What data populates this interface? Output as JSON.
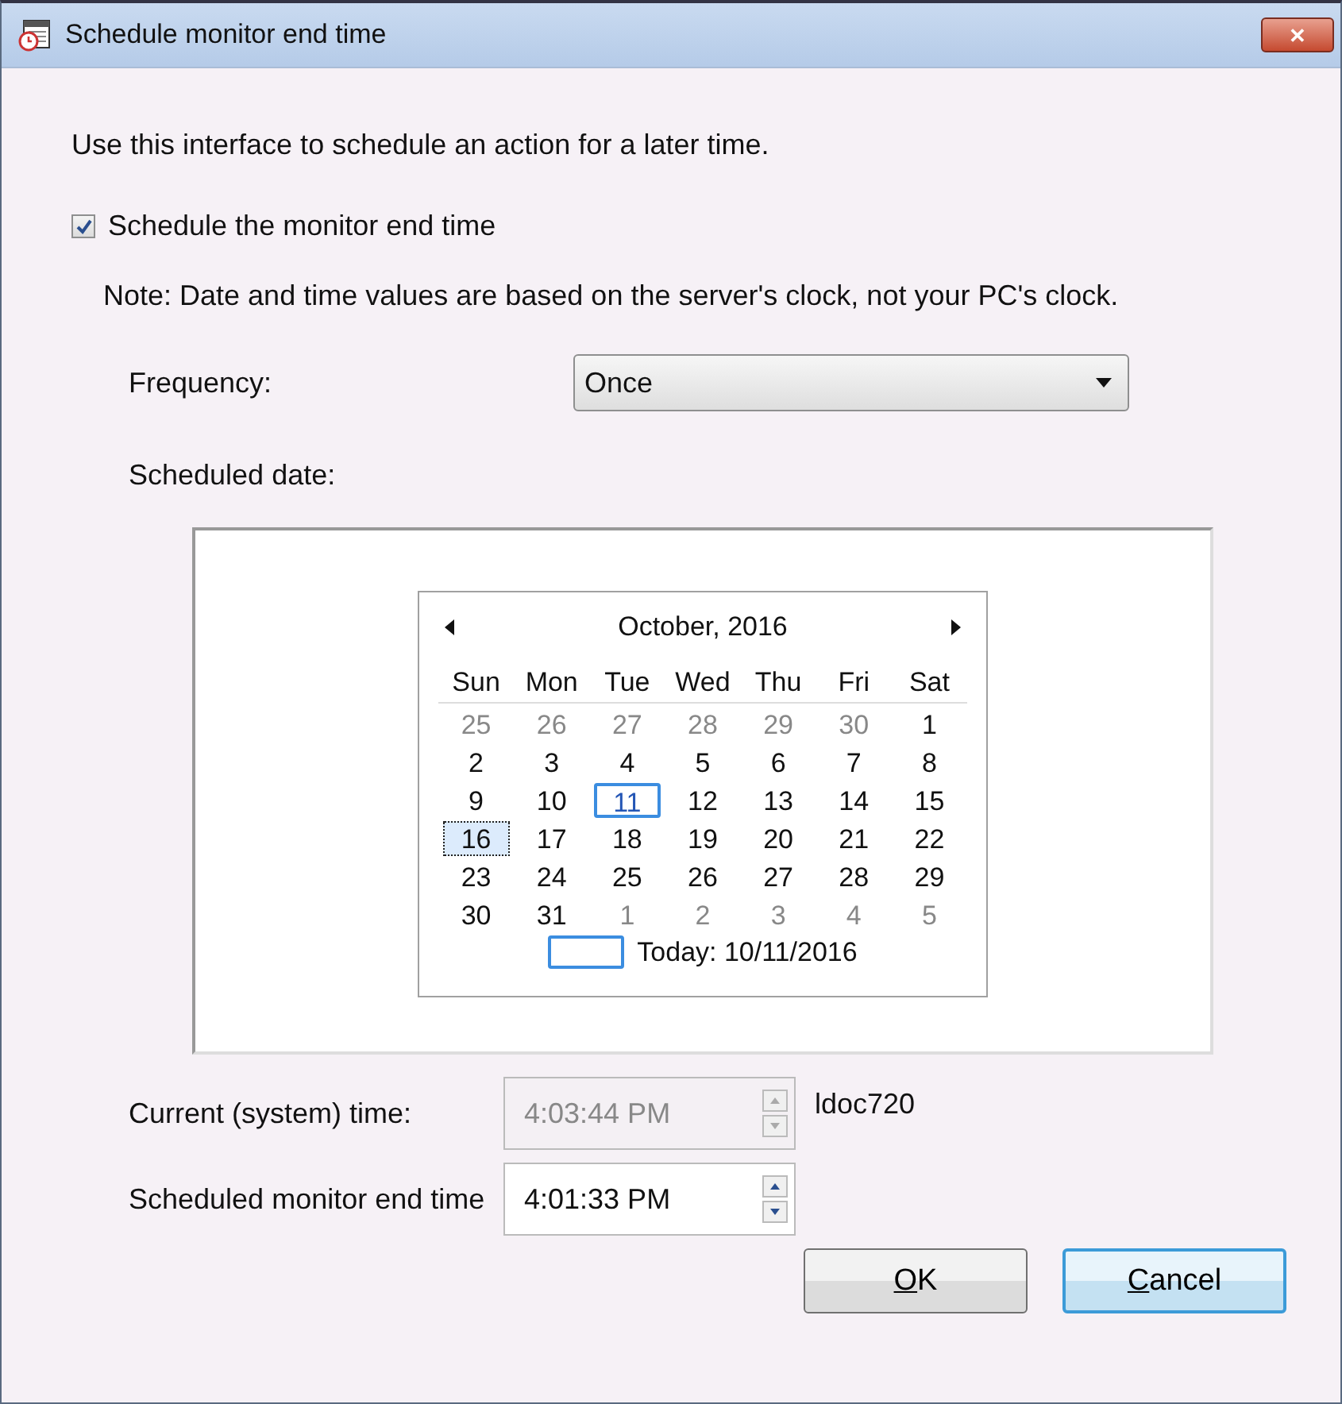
{
  "window": {
    "title": "Schedule monitor end time",
    "close_label": "✕"
  },
  "intro": "Use this interface to schedule an action for a later time.",
  "schedule_checkbox": {
    "label": "Schedule the monitor end time",
    "checked": true
  },
  "note": "Note:  Date and time values are based on the server's clock, not your PC's clock.",
  "frequency": {
    "label": "Frequency:",
    "value": "Once"
  },
  "scheduled_date_label": "Scheduled date:",
  "calendar": {
    "month": "October, 2016",
    "weekdays": [
      "Sun",
      "Mon",
      "Tue",
      "Wed",
      "Thu",
      "Fri",
      "Sat"
    ],
    "days": [
      {
        "label": "25",
        "other_month": true,
        "selected": false,
        "today": false
      },
      {
        "label": "26",
        "other_month": true,
        "selected": false,
        "today": false
      },
      {
        "label": "27",
        "other_month": true,
        "selected": false,
        "today": false
      },
      {
        "label": "28",
        "other_month": true,
        "selected": false,
        "today": false
      },
      {
        "label": "29",
        "other_month": true,
        "selected": false,
        "today": false
      },
      {
        "label": "30",
        "other_month": true,
        "selected": false,
        "today": false
      },
      {
        "label": "1",
        "other_month": false,
        "selected": false,
        "today": false
      },
      {
        "label": "2",
        "other_month": false,
        "selected": false,
        "today": false
      },
      {
        "label": "3",
        "other_month": false,
        "selected": false,
        "today": false
      },
      {
        "label": "4",
        "other_month": false,
        "selected": false,
        "today": false
      },
      {
        "label": "5",
        "other_month": false,
        "selected": false,
        "today": false
      },
      {
        "label": "6",
        "other_month": false,
        "selected": false,
        "today": false
      },
      {
        "label": "7",
        "other_month": false,
        "selected": false,
        "today": false
      },
      {
        "label": "8",
        "other_month": false,
        "selected": false,
        "today": false
      },
      {
        "label": "9",
        "other_month": false,
        "selected": false,
        "today": false
      },
      {
        "label": "10",
        "other_month": false,
        "selected": false,
        "today": false
      },
      {
        "label": "11",
        "other_month": false,
        "selected": false,
        "today": true
      },
      {
        "label": "12",
        "other_month": false,
        "selected": false,
        "today": false
      },
      {
        "label": "13",
        "other_month": false,
        "selected": false,
        "today": false
      },
      {
        "label": "14",
        "other_month": false,
        "selected": false,
        "today": false
      },
      {
        "label": "15",
        "other_month": false,
        "selected": false,
        "today": false
      },
      {
        "label": "16",
        "other_month": false,
        "selected": true,
        "today": false
      },
      {
        "label": "17",
        "other_month": false,
        "selected": false,
        "today": false
      },
      {
        "label": "18",
        "other_month": false,
        "selected": false,
        "today": false
      },
      {
        "label": "19",
        "other_month": false,
        "selected": false,
        "today": false
      },
      {
        "label": "20",
        "other_month": false,
        "selected": false,
        "today": false
      },
      {
        "label": "21",
        "other_month": false,
        "selected": false,
        "today": false
      },
      {
        "label": "22",
        "other_month": false,
        "selected": false,
        "today": false
      },
      {
        "label": "23",
        "other_month": false,
        "selected": false,
        "today": false
      },
      {
        "label": "24",
        "other_month": false,
        "selected": false,
        "today": false
      },
      {
        "label": "25",
        "other_month": false,
        "selected": false,
        "today": false
      },
      {
        "label": "26",
        "other_month": false,
        "selected": false,
        "today": false
      },
      {
        "label": "27",
        "other_month": false,
        "selected": false,
        "today": false
      },
      {
        "label": "28",
        "other_month": false,
        "selected": false,
        "today": false
      },
      {
        "label": "29",
        "other_month": false,
        "selected": false,
        "today": false
      },
      {
        "label": "30",
        "other_month": false,
        "selected": false,
        "today": false
      },
      {
        "label": "31",
        "other_month": false,
        "selected": false,
        "today": false
      },
      {
        "label": "1",
        "other_month": true,
        "selected": false,
        "today": false
      },
      {
        "label": "2",
        "other_month": true,
        "selected": false,
        "today": false
      },
      {
        "label": "3",
        "other_month": true,
        "selected": false,
        "today": false
      },
      {
        "label": "4",
        "other_month": true,
        "selected": false,
        "today": false
      },
      {
        "label": "5",
        "other_month": true,
        "selected": false,
        "today": false
      }
    ],
    "today_text": "Today: 10/11/2016"
  },
  "current_time": {
    "label": "Current (system) time:",
    "value": "4:03:44 PM",
    "disabled": true,
    "host": "ldoc720"
  },
  "end_time": {
    "label": "Scheduled monitor end time",
    "value": "4:01:33 PM",
    "disabled": false
  },
  "buttons": [
    {
      "label": "OK",
      "default": false
    },
    {
      "label": "Cancel",
      "default": true
    }
  ]
}
